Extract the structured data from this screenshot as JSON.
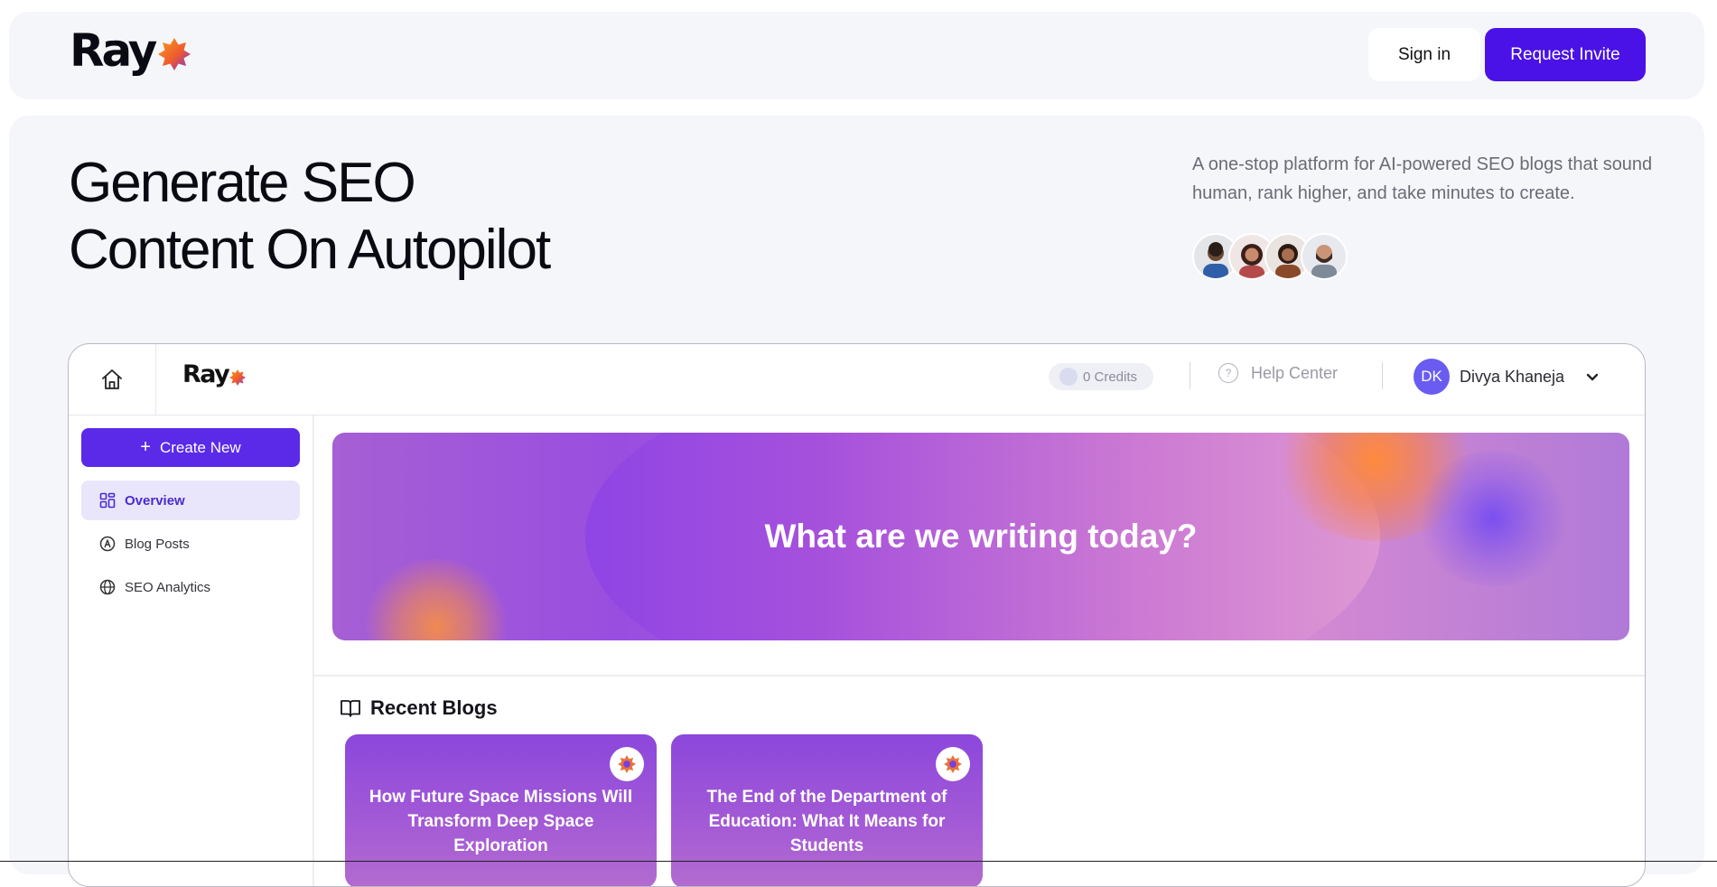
{
  "nav": {
    "logo_text": "Ray",
    "signin_label": "Sign in",
    "request_label": "Request Invite"
  },
  "hero": {
    "headline_line1": "Generate SEO",
    "headline_line2": "Content On Autopilot",
    "tagline": "A one-stop platform for AI-powered SEO blogs that sound human, rank higher, and take minutes to create.",
    "avatars": [
      "avatar-1",
      "avatar-2",
      "avatar-3",
      "avatar-4"
    ]
  },
  "app": {
    "logo_text": "Ray",
    "credits_label": "0 Credits",
    "help_label": "Help Center",
    "user_initials": "DK",
    "user_name": "Divya Khaneja",
    "create_label": "Create New",
    "sidebar": {
      "items": [
        {
          "label": "Overview",
          "icon": "grid-icon",
          "active": true
        },
        {
          "label": "Blog Posts",
          "icon": "pen-circle-icon",
          "active": false
        },
        {
          "label": "SEO Analytics",
          "icon": "globe-icon",
          "active": false
        }
      ]
    },
    "banner_title": "What are we writing today?",
    "recent_title": "Recent Blogs",
    "cards": [
      {
        "title": "How Future Space Missions Will Transform Deep Space Exploration"
      },
      {
        "title": "The End of the Department of Education: What It Means for Students"
      }
    ]
  },
  "colors": {
    "accent": "#4a12e6",
    "create_button": "#5b2ae8",
    "panel_bg": "#f5f6fa",
    "user_avatar": "#6a5cf0"
  }
}
